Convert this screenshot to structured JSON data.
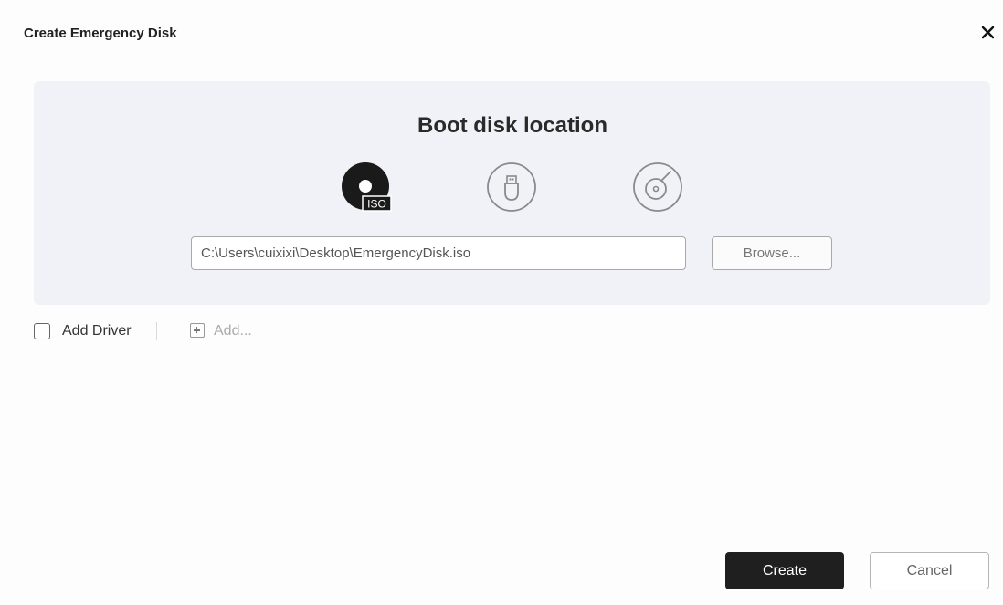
{
  "dialog": {
    "title": "Create Emergency Disk",
    "close_icon": "close-icon"
  },
  "location": {
    "heading": "Boot disk location",
    "options": [
      {
        "id": "iso",
        "icon": "iso-disk-icon",
        "badge": "ISO",
        "selected": true
      },
      {
        "id": "usb",
        "icon": "usb-drive-icon",
        "selected": false
      },
      {
        "id": "cd",
        "icon": "cd-disc-icon",
        "selected": false
      }
    ],
    "path_value": "C:\\Users\\cuixixi\\Desktop\\EmergencyDisk.iso",
    "browse_label": "Browse..."
  },
  "driver": {
    "checkbox_label": "Add Driver",
    "checked": false,
    "add_label": "Add..."
  },
  "footer": {
    "create_label": "Create",
    "cancel_label": "Cancel"
  },
  "colors": {
    "panel_bg": "#f0f2f7",
    "primary_button": "#1f1f1f",
    "selected_icon": "#1a1a1a",
    "unselected_icon": "#8a8a8a"
  }
}
